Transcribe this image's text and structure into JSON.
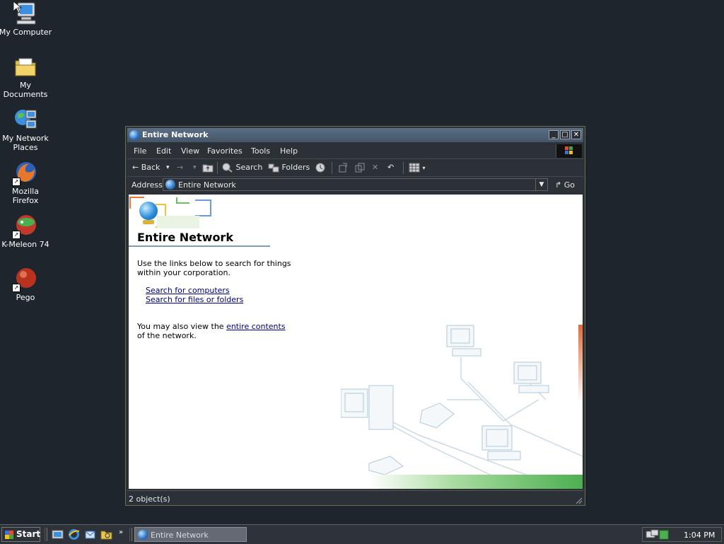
{
  "desktop": {
    "icons": [
      {
        "label": "My Computer",
        "icon": "computer-icon"
      },
      {
        "label": "My Documents",
        "icon": "folder-icon"
      },
      {
        "label": "My Network\nPlaces",
        "icon": "network-places-icon"
      },
      {
        "label": "Mozilla Firefox",
        "icon": "firefox-icon"
      },
      {
        "label": "K-Meleon 74",
        "icon": "kmeleon-icon"
      },
      {
        "label": "Pego",
        "icon": "pego-icon"
      }
    ]
  },
  "window": {
    "title": "Entire Network",
    "menu": [
      "File",
      "Edit",
      "View",
      "Favorites",
      "Tools",
      "Help"
    ],
    "toolbar": {
      "back_label": "Back",
      "search_label": "Search",
      "folders_label": "Folders"
    },
    "address": {
      "label": "Address",
      "value": "Entire Network",
      "go_label": "Go"
    },
    "content": {
      "heading": "Entire Network",
      "intro_line1": "Use the links below to search for things",
      "intro_line2": "within your corporation.",
      "link_computers": "Search for computers",
      "link_files": "Search for files or folders",
      "also_prefix": "You may also view the ",
      "also_link": "entire contents",
      "also_suffix": "of the network."
    },
    "status": "2 object(s)"
  },
  "taskbar": {
    "start_label": "Start",
    "task_label": "Entire Network",
    "clock": "1:04 PM"
  },
  "colors": {
    "desktop": "#1f252c",
    "window_frame": "#2c3138",
    "title_gradient_top": "#5b6e86",
    "link": "#00007f"
  }
}
